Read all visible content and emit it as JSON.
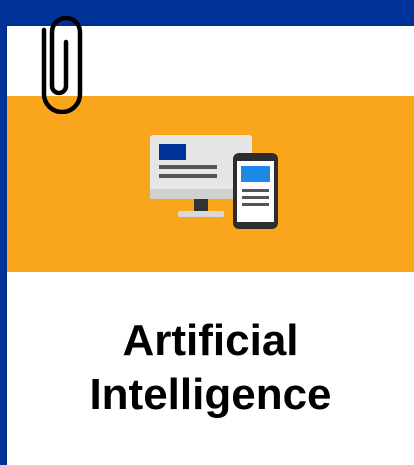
{
  "card": {
    "title_line1": "Artificial",
    "title_line2": "Intelligence"
  },
  "icons": {
    "illustration": "desktop-and-mobile-device-icon",
    "clip": "paperclip-icon"
  },
  "colors": {
    "frame": "#003399",
    "banner": "#f9a61c",
    "card": "#ffffff",
    "title_text": "#000000"
  }
}
